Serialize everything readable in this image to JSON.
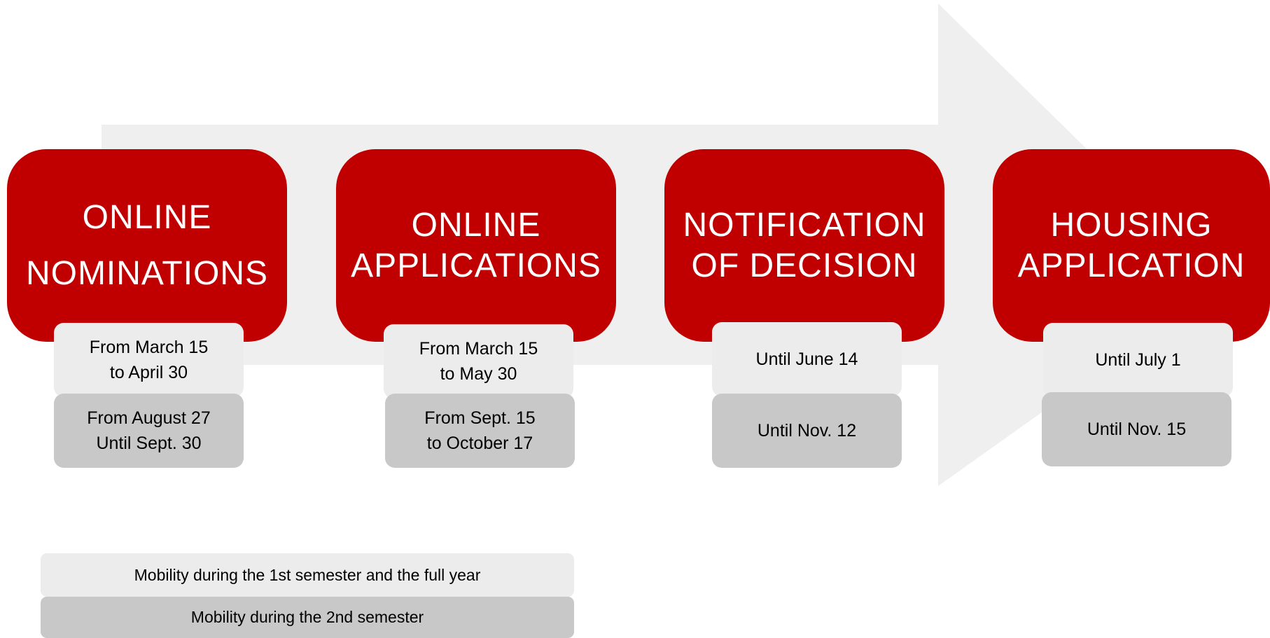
{
  "colors": {
    "step_fill": "#c00000",
    "first_period_fill": "#ececec",
    "second_period_fill": "#c8c8c8",
    "arrow_fill": "#efefef"
  },
  "steps": [
    {
      "title": "ONLINE\nNOMINATIONS",
      "first_period": "From March 15\nto April 30",
      "second_period": "From August 27\nUntil Sept. 30"
    },
    {
      "title": "ONLINE\nAPPLICATIONS",
      "first_period": "From March 15\nto May 30",
      "second_period": "From Sept. 15\nto October 17"
    },
    {
      "title": "NOTIFICATION\nOF DECISION",
      "first_period": "Until June 14",
      "second_period": "Until Nov. 12"
    },
    {
      "title": "HOUSING\nAPPLICATION",
      "first_period": "Until July 1",
      "second_period": "Until Nov. 15"
    }
  ],
  "legend": {
    "first_period": "Mobility during the 1st semester and the full year",
    "second_period": "Mobility during the 2nd semester"
  }
}
